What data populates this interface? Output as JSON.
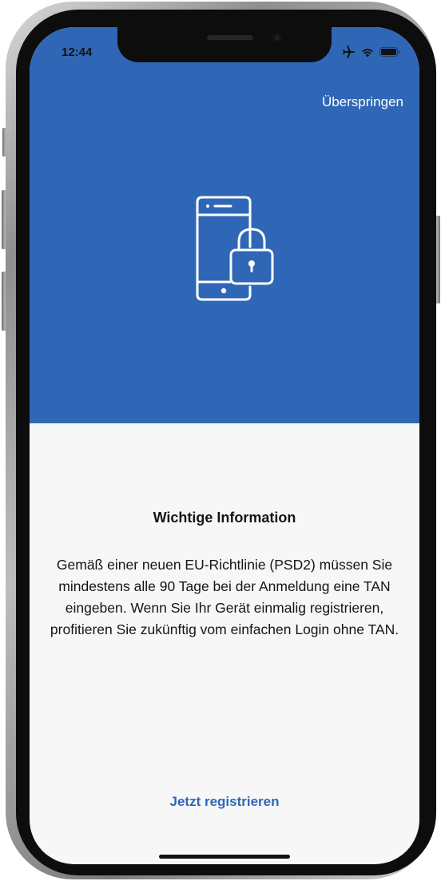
{
  "status_bar": {
    "time": "12:44",
    "icons": [
      "airplane-icon",
      "wifi-icon",
      "battery-icon"
    ]
  },
  "header": {
    "skip_label": "Überspringen"
  },
  "hero": {
    "icon": "phone-lock-icon"
  },
  "main": {
    "title": "Wichtige Information",
    "body": "Gemäß einer neuen EU-Richtlinie (PSD2) müssen Sie mindestens alle 90 Tage bei der Anmeldung eine TAN eingeben. Wenn Sie Ihr Gerät einmalig registrieren, profitieren Sie zukünftig vom einfachen Login ohne TAN.",
    "register_label": "Jetzt registrieren"
  },
  "colors": {
    "accent": "#2f67b6",
    "background": "#f7f7f7",
    "text": "#151515"
  }
}
